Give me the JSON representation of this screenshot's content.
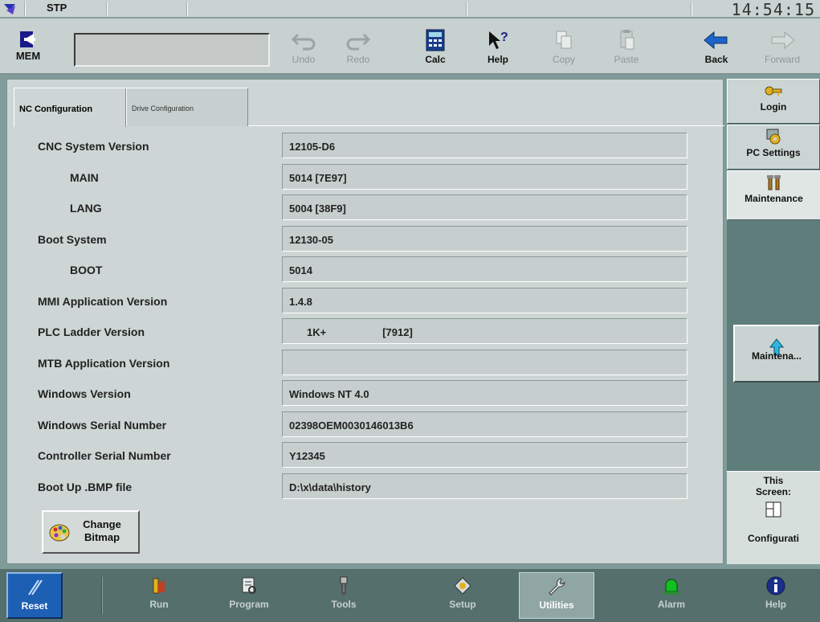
{
  "status": {
    "mode": "STP",
    "clock": "14:54:15"
  },
  "toolbar": {
    "mem_label": "MEM",
    "mem_value": "",
    "buttons": [
      {
        "label": "Undo",
        "icon": "undo-icon",
        "enabled": false
      },
      {
        "label": "Redo",
        "icon": "redo-icon",
        "enabled": false
      },
      {
        "label": "Calc",
        "icon": "calculator-icon",
        "enabled": true
      },
      {
        "label": "Help",
        "icon": "help-cursor-icon",
        "enabled": true
      },
      {
        "label": "Copy",
        "icon": "copy-icon",
        "enabled": false
      },
      {
        "label": "Paste",
        "icon": "paste-icon",
        "enabled": false
      },
      {
        "label": "Back",
        "icon": "back-arrow-icon",
        "enabled": true
      },
      {
        "label": "Forward",
        "icon": "forward-arrow-icon",
        "enabled": false
      }
    ]
  },
  "tabs": [
    {
      "label": "NC Configuration",
      "active": true
    },
    {
      "label": "Drive Configuration",
      "active": false
    }
  ],
  "rows": [
    {
      "label": "CNC System Version",
      "value": "12105-D6",
      "indent": false
    },
    {
      "label": "MAIN",
      "value": "5014 [7E97]",
      "indent": true
    },
    {
      "label": "LANG",
      "value": "5004 [38F9]",
      "indent": true
    },
    {
      "label": "Boot System",
      "value": "12130-05",
      "indent": false
    },
    {
      "label": "BOOT",
      "value": "5014",
      "indent": true
    },
    {
      "label": "MMI Application Version",
      "value": "1.4.8",
      "indent": false
    },
    {
      "label": "PLC Ladder Version",
      "value": "1K+",
      "value2": "[7912]",
      "indent": false
    },
    {
      "label": "MTB Application Version",
      "value": "",
      "indent": false
    },
    {
      "label": "Windows Version",
      "value": "Windows NT 4.0",
      "indent": false
    },
    {
      "label": "Windows Serial Number",
      "value": "02398OEM0030146013B6",
      "indent": false
    },
    {
      "label": "Controller Serial Number",
      "value": "Y12345",
      "indent": false
    },
    {
      "label": "Boot Up .BMP file",
      "value": "D:\\x\\data\\history",
      "indent": false
    }
  ],
  "change_bitmap": {
    "line1": "Change",
    "line2": "Bitmap"
  },
  "side": {
    "login": "Login",
    "pc_settings": "PC Settings",
    "maintenance": "Maintenance",
    "mainte_button": "Maintena...",
    "this_screen_1": "This",
    "this_screen_2": "Screen:",
    "configuration": "Configurati"
  },
  "bottom": {
    "reset": "Reset",
    "items": [
      {
        "label": "Run",
        "icon": "run-icon"
      },
      {
        "label": "Program",
        "icon": "program-icon"
      },
      {
        "label": "Tools",
        "icon": "tools-icon"
      },
      {
        "label": "Setup",
        "icon": "setup-icon"
      },
      {
        "label": "Utilities",
        "icon": "wrench-icon",
        "active": true
      },
      {
        "label": "Alarm",
        "icon": "alarm-light-icon"
      },
      {
        "label": "Help",
        "icon": "info-icon"
      }
    ]
  },
  "colors": {
    "reset_blue": "#1d5fb3",
    "panel": "#cdd6d4",
    "side_dark": "#5f7d7b"
  }
}
